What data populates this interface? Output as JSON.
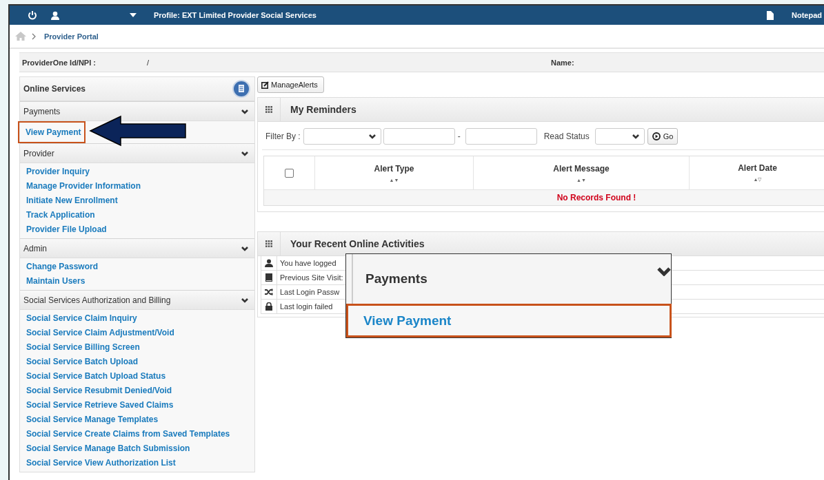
{
  "header": {
    "profile": "Profile: EXT Limited Provider Social Services",
    "notepad": "Notepad"
  },
  "breadcrumb": [
    "Provider Portal"
  ],
  "info": {
    "provider_label": "ProviderOne Id/NPI :",
    "provider_value": "/",
    "name_label": "Name:"
  },
  "sidebar": {
    "title": "Online Services",
    "sections": [
      {
        "title": "Payments",
        "expanded": true,
        "items": [
          {
            "label": "View Payment",
            "highlighted": true
          }
        ]
      },
      {
        "title": "Provider",
        "expanded": true,
        "items": [
          {
            "label": "Provider Inquiry",
            "highlighted": false
          },
          {
            "label": "Manage Provider Information",
            "highlighted": false
          },
          {
            "label": "Initiate New Enrollment",
            "highlighted": false
          },
          {
            "label": "Track Application",
            "highlighted": false
          },
          {
            "label": "Provider File Upload",
            "highlighted": false
          }
        ]
      },
      {
        "title": "Admin",
        "expanded": true,
        "items": [
          {
            "label": "Change Password",
            "highlighted": false
          },
          {
            "label": "Maintain Users",
            "highlighted": false
          }
        ]
      },
      {
        "title": "Social Services Authorization and Billing",
        "expanded": true,
        "items": [
          {
            "label": "Social Service Claim Inquiry",
            "highlighted": false
          },
          {
            "label": "Social Service Claim Adjustment/Void",
            "highlighted": false
          },
          {
            "label": "Social Service Billing Screen",
            "highlighted": false
          },
          {
            "label": "Social Service Batch Upload",
            "highlighted": false
          },
          {
            "label": "Social Service Batch Upload Status",
            "highlighted": false
          },
          {
            "label": "Social Service Resubmit Denied/Void",
            "highlighted": false
          },
          {
            "label": "Social Service Retrieve Saved Claims",
            "highlighted": false
          },
          {
            "label": "Social Service Manage Templates",
            "highlighted": false
          },
          {
            "label": "Social Service Create Claims from Saved Templates",
            "highlighted": false
          },
          {
            "label": "Social Service Manage Batch Submission",
            "highlighted": false
          },
          {
            "label": "Social Service View Authorization List",
            "highlighted": false
          }
        ]
      }
    ]
  },
  "reminders": {
    "manage_button": "ManageAlerts",
    "title": "My Reminders",
    "filter_label": "Filter By :",
    "separator": "-",
    "read_status_label": "Read Status",
    "go_button": "Go",
    "columns": [
      {
        "label": "Alert Type",
        "sort": "▲▼"
      },
      {
        "label": "Alert Message",
        "sort": "▲▼"
      },
      {
        "label": "Alert Date",
        "sort": "▲▽"
      }
    ],
    "select_all_checked": false,
    "empty_message": "No Records Found !"
  },
  "activities": {
    "title": "Your Recent Online Activities",
    "rows": [
      {
        "kind": "user",
        "text": "You have logged"
      },
      {
        "kind": "book",
        "text": "Previous Site Visit:"
      },
      {
        "kind": "shuffle",
        "text": "Last Login Passw"
      },
      {
        "kind": "lock",
        "text": "Last login failed"
      }
    ]
  },
  "callout": {
    "title": "Payments",
    "item": "View Payment"
  }
}
